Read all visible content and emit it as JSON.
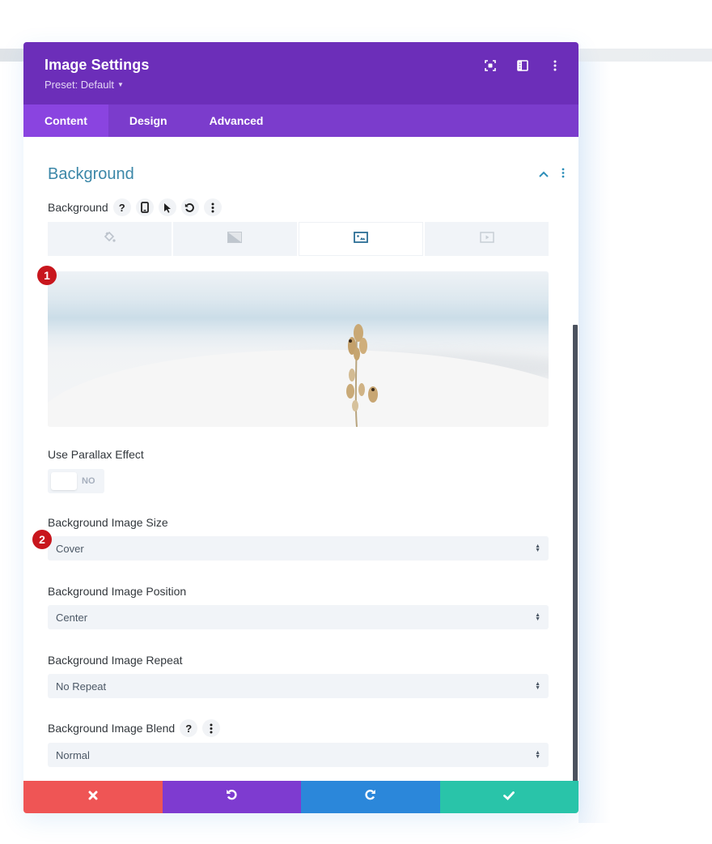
{
  "modal": {
    "title": "Image Settings",
    "preset": "Preset: Default",
    "header_icons": [
      "focus-mode-icon",
      "split-view-icon",
      "more-options-icon"
    ]
  },
  "tabs": [
    {
      "label": "Content",
      "active": true
    },
    {
      "label": "Design",
      "active": false
    },
    {
      "label": "Advanced",
      "active": false
    }
  ],
  "section": {
    "title": "Background",
    "controls": [
      "collapse-chevron-up-icon",
      "section-more-icon"
    ]
  },
  "background_field": {
    "label": "Background",
    "icons": [
      "help-icon",
      "responsive-phone-icon",
      "hover-cursor-icon",
      "reset-undo-icon",
      "more-options-icon"
    ],
    "type_tabs": [
      {
        "icon": "color-fill-bucket-icon",
        "active": false
      },
      {
        "icon": "gradient-icon",
        "active": false
      },
      {
        "icon": "image-icon",
        "active": true
      },
      {
        "icon": "video-icon",
        "active": false
      }
    ]
  },
  "badges": [
    "1",
    "2"
  ],
  "parallax": {
    "label": "Use Parallax Effect",
    "state": "NO"
  },
  "selects": [
    {
      "label": "Background Image Size",
      "value": "Cover"
    },
    {
      "label": "Background Image Position",
      "value": "Center"
    },
    {
      "label": "Background Image Repeat",
      "value": "No Repeat"
    },
    {
      "label": "Background Image Blend",
      "value": "Normal",
      "icons": [
        "help-icon",
        "more-options-icon"
      ]
    }
  ],
  "footer": {
    "buttons": [
      {
        "action": "cancel",
        "icon": "close-x-icon",
        "color": "#ef5555"
      },
      {
        "action": "undo",
        "icon": "undo-icon",
        "color": "#7e3bd0"
      },
      {
        "action": "redo",
        "icon": "redo-icon",
        "color": "#2b87da"
      },
      {
        "action": "save",
        "icon": "checkmark-icon",
        "color": "#29c4a9"
      }
    ]
  },
  "colors": {
    "header": "#6c2eb9",
    "tab_bar": "#7b3ccc",
    "tab_active": "#8a44e0",
    "section_title": "#3b87a8",
    "badge": "#c8161d"
  }
}
